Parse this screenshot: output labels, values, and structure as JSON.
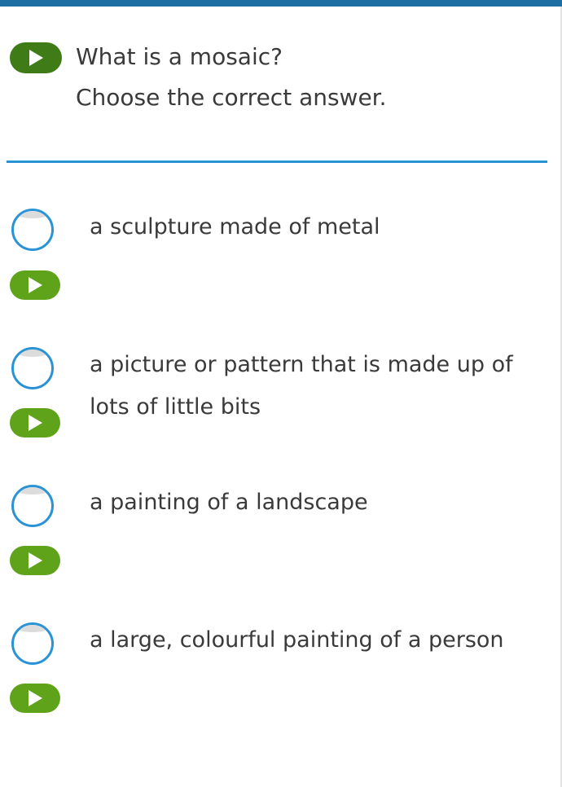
{
  "question": {
    "text": "What is a mosaic?",
    "instruction": "Choose the correct answer."
  },
  "options": [
    {
      "label": "a sculpture made of metal"
    },
    {
      "label": "a picture or pattern that is made up of lots of little bits"
    },
    {
      "label": "a painting of a landscape"
    },
    {
      "label": "a large, colourful painting of a person"
    }
  ],
  "icons": {
    "audio": "play-icon",
    "select": "radio-circle"
  },
  "colors": {
    "header_bar": "#1d6fa3",
    "question_play": "#3f7b16",
    "option_play": "#5fa31a",
    "accent_blue": "#2a93d5"
  }
}
